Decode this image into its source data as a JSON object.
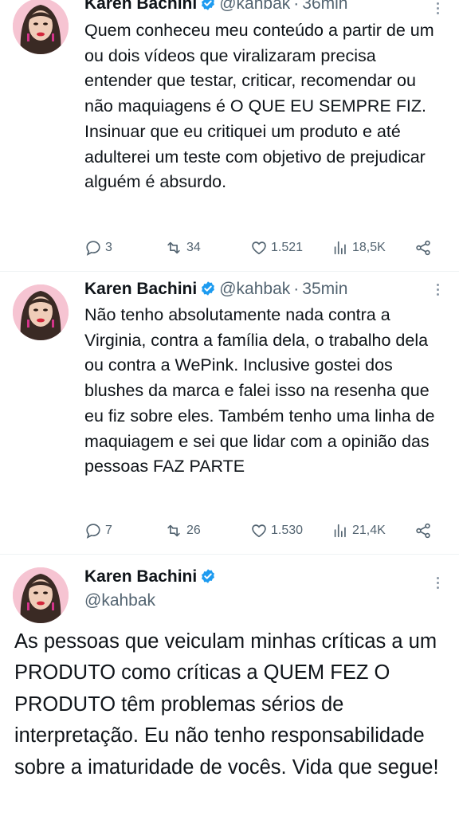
{
  "tweets": [
    {
      "name": "Karen Bachini",
      "handle": "@kahbak",
      "time": "36min",
      "text": "Quem conheceu meu conteúdo a partir de um ou dois vídeos que viralizaram precisa entender que testar, criticar, recomendar ou não maquiagens é O QUE EU SEMPRE FIZ. Insinuar que eu critiquei um produto e até adulterei um teste com objetivo de prejudicar alguém é absurdo.",
      "replies": "3",
      "retweets": "34",
      "likes": "1.521",
      "views": "18,5K"
    },
    {
      "name": "Karen Bachini",
      "handle": "@kahbak",
      "time": "35min",
      "text": "Não tenho absolutamente nada contra a Virginia, contra a família dela, o trabalho dela ou contra a WePink. Inclusive gostei dos blushes da marca e falei isso na resenha que eu fiz sobre eles. Também tenho uma linha de maquiagem e sei que lidar com a opinião das pessoas FAZ PARTE",
      "replies": "7",
      "retweets": "26",
      "likes": "1.530",
      "views": "21,4K"
    }
  ],
  "focus_tweet": {
    "name": "Karen Bachini",
    "handle": "@kahbak",
    "text": "As pessoas que veiculam minhas críticas a um PRODUTO como críticas a QUEM FEZ O PRODUTO têm problemas sérios de interpretação. Eu não tenho responsabilidade sobre a imaturidade de vocês. Vida que segue!"
  },
  "separator": "·",
  "colors": {
    "text": "#0f1419",
    "secondary": "#536471",
    "verified": "#1d9bf0",
    "divider": "#eff3f4"
  },
  "icons": [
    "reply-icon",
    "retweet-icon",
    "like-icon",
    "views-icon",
    "share-icon",
    "verified-badge-icon",
    "more-icon"
  ]
}
